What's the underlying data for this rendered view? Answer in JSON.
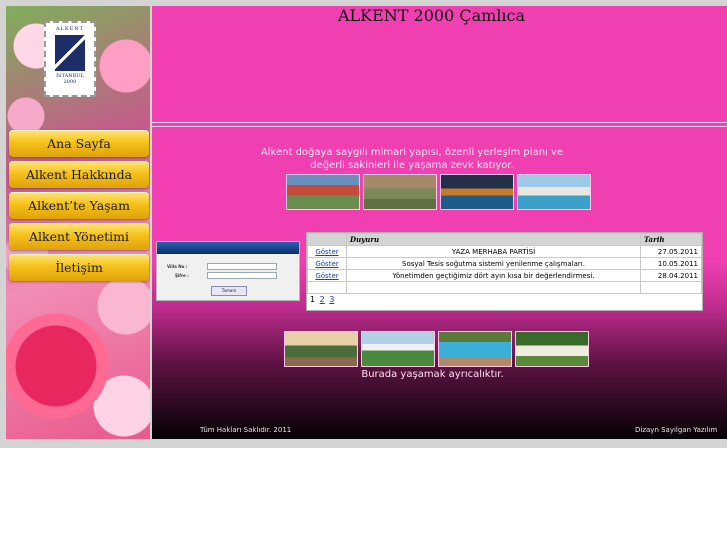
{
  "logo": {
    "top_text": "ALKENT",
    "bottom_line1": "İSTANBUL",
    "bottom_line2": "2000"
  },
  "menu": [
    {
      "label": "Ana Sayfa"
    },
    {
      "label": "Alkent Hakkında"
    },
    {
      "label": "Alkent’te Yaşam"
    },
    {
      "label": "Alkent Yönetimi"
    },
    {
      "label": "İletişim"
    }
  ],
  "site_title": "ALKENT 2000 Çamlıca",
  "tagline": "Alkent doğaya saygılı mimari yapısı, özenli yerleşim planı ve değerli sakinleri ile yaşama zevk katıyor.",
  "login": {
    "villa_label": "Villa No :",
    "password_label": "Şifre :",
    "submit_label": "Tamam"
  },
  "notices": {
    "header_date_col": "Duyuru",
    "header_date": "Tarih",
    "rows": [
      {
        "link": "Göster",
        "title": "YAZA MERHABA PARTİSİ",
        "date": "27.05.2011"
      },
      {
        "link": "Göster",
        "title": "Sosyal Tesis soğutma sistemi yenilenme çalışmaları.",
        "date": "10.05.2011"
      },
      {
        "link": "Göster",
        "title": "Yönetimden geçtiğimiz dört ayın kısa bir değerlendirmesi.",
        "date": "28.04.2011"
      }
    ],
    "pages": [
      "1",
      "2",
      "3"
    ]
  },
  "slogan": "Burada yaşamak ayrıcalıktır.",
  "footer": {
    "left": "Tüm  Hakları Saklıdır. 2011",
    "right": "Dizayn Sayılgan Yazılım"
  },
  "colors": {
    "main_pink": "#ef3fb1",
    "menu_gold": "#f5c21a",
    "link_blue": "#1a3cc8"
  }
}
